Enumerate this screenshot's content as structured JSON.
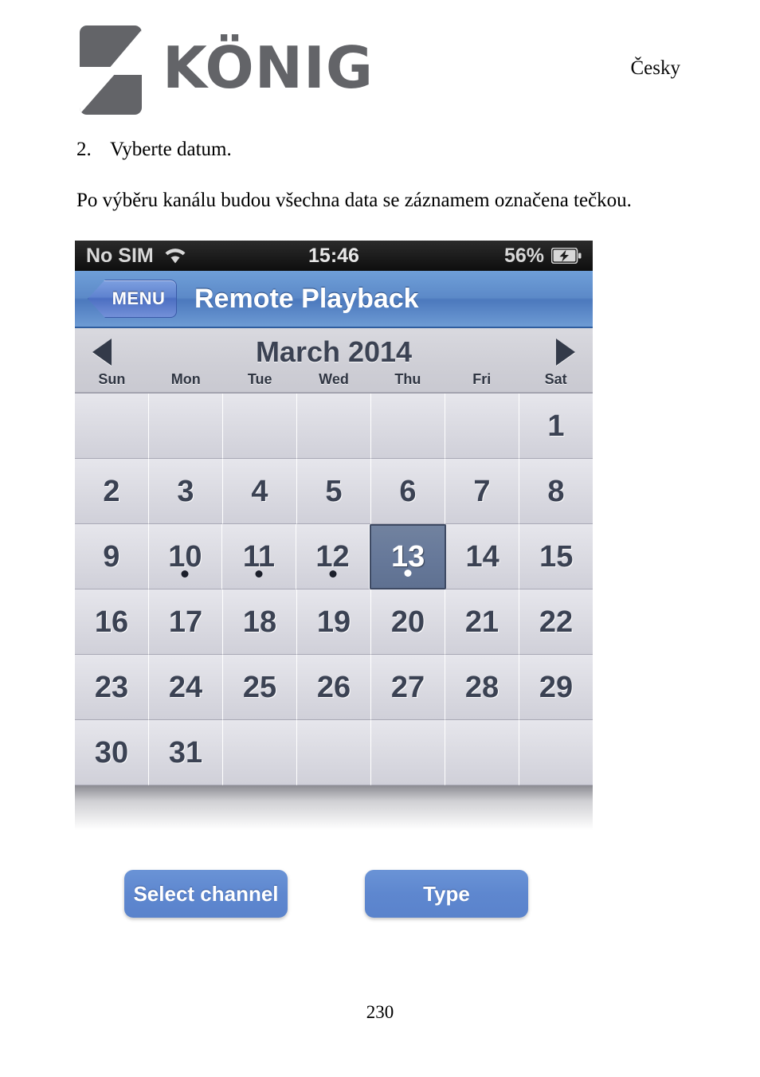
{
  "document": {
    "brand": "KÖNIG",
    "language_label": "Česky",
    "page_number": "230",
    "step_number": "2.",
    "step_text": "Vyberte datum.",
    "paragraph": "Po výběru kanálu budou všechna data se záznamem označena tečkou."
  },
  "phone": {
    "status_bar": {
      "carrier": "No SIM",
      "wifi_icon": "wifi-icon",
      "time": "15:46",
      "battery_percent": "56%",
      "battery_icon": "battery-charging-icon"
    },
    "nav_bar": {
      "back_label": "MENU",
      "title": "Remote Playback"
    },
    "calendar": {
      "prev_icon": "triangle-left-icon",
      "next_icon": "triangle-right-icon",
      "month_title": "March 2014",
      "weekdays": [
        "Sun",
        "Mon",
        "Tue",
        "Wed",
        "Thu",
        "Fri",
        "Sat"
      ],
      "selected_day": "13",
      "days_with_recordings": [
        "10",
        "11",
        "12",
        "13"
      ],
      "weeks": [
        [
          {
            "day": "",
            "dot": false,
            "selected": false
          },
          {
            "day": "",
            "dot": false,
            "selected": false
          },
          {
            "day": "",
            "dot": false,
            "selected": false
          },
          {
            "day": "",
            "dot": false,
            "selected": false
          },
          {
            "day": "",
            "dot": false,
            "selected": false
          },
          {
            "day": "",
            "dot": false,
            "selected": false
          },
          {
            "day": "1",
            "dot": false,
            "selected": false
          }
        ],
        [
          {
            "day": "2",
            "dot": false,
            "selected": false
          },
          {
            "day": "3",
            "dot": false,
            "selected": false
          },
          {
            "day": "4",
            "dot": false,
            "selected": false
          },
          {
            "day": "5",
            "dot": false,
            "selected": false
          },
          {
            "day": "6",
            "dot": false,
            "selected": false
          },
          {
            "day": "7",
            "dot": false,
            "selected": false
          },
          {
            "day": "8",
            "dot": false,
            "selected": false
          }
        ],
        [
          {
            "day": "9",
            "dot": false,
            "selected": false
          },
          {
            "day": "10",
            "dot": true,
            "selected": false
          },
          {
            "day": "11",
            "dot": true,
            "selected": false
          },
          {
            "day": "12",
            "dot": true,
            "selected": false
          },
          {
            "day": "13",
            "dot": true,
            "selected": true
          },
          {
            "day": "14",
            "dot": false,
            "selected": false
          },
          {
            "day": "15",
            "dot": false,
            "selected": false
          }
        ],
        [
          {
            "day": "16",
            "dot": false,
            "selected": false
          },
          {
            "day": "17",
            "dot": false,
            "selected": false
          },
          {
            "day": "18",
            "dot": false,
            "selected": false
          },
          {
            "day": "19",
            "dot": false,
            "selected": false
          },
          {
            "day": "20",
            "dot": false,
            "selected": false
          },
          {
            "day": "21",
            "dot": false,
            "selected": false
          },
          {
            "day": "22",
            "dot": false,
            "selected": false
          }
        ],
        [
          {
            "day": "23",
            "dot": false,
            "selected": false
          },
          {
            "day": "24",
            "dot": false,
            "selected": false
          },
          {
            "day": "25",
            "dot": false,
            "selected": false
          },
          {
            "day": "26",
            "dot": false,
            "selected": false
          },
          {
            "day": "27",
            "dot": false,
            "selected": false
          },
          {
            "day": "28",
            "dot": false,
            "selected": false
          },
          {
            "day": "29",
            "dot": false,
            "selected": false
          }
        ],
        [
          {
            "day": "30",
            "dot": false,
            "selected": false
          },
          {
            "day": "31",
            "dot": false,
            "selected": false
          },
          {
            "day": "",
            "dot": false,
            "selected": false
          },
          {
            "day": "",
            "dot": false,
            "selected": false
          },
          {
            "day": "",
            "dot": false,
            "selected": false
          },
          {
            "day": "",
            "dot": false,
            "selected": false
          },
          {
            "day": "",
            "dot": false,
            "selected": false
          }
        ]
      ]
    },
    "buttons": {
      "select_channel": "Select channel",
      "type": "Type"
    }
  },
  "colors": {
    "nav_blue": "#5c89c8",
    "button_blue": "#5e87cf",
    "selected_day_bg": "#67799a",
    "logo_gray": "#636468",
    "status_bar_bg": "#1d1d1d"
  }
}
